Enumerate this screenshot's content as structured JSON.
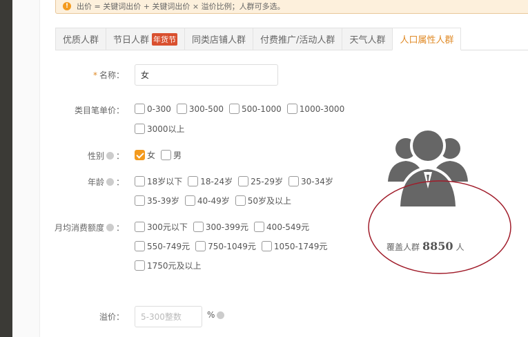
{
  "notice": {
    "text": "出价 = 关键词出价 + 关键词出价 × 溢价比例；人群可多选。"
  },
  "tabs": [
    {
      "label": "优质人群"
    },
    {
      "label": "节日人群",
      "badge": "年货节"
    },
    {
      "label": "同类店铺人群"
    },
    {
      "label": "付费推广/活动人群"
    },
    {
      "label": "天气人群"
    },
    {
      "label": "人口属性人群",
      "active": true
    }
  ],
  "form": {
    "name": {
      "label": "名称：",
      "required": "*",
      "value": "女"
    },
    "price": {
      "label": "类目笔单价：",
      "options": [
        "0-300",
        "300-500",
        "500-1000",
        "1000-3000",
        "3000以上"
      ]
    },
    "gender": {
      "label": "性别",
      "colon": "：",
      "options": [
        "女",
        "男"
      ],
      "checked": "女"
    },
    "age": {
      "label": "年龄",
      "colon": "：",
      "options": [
        "18岁以下",
        "18-24岁",
        "25-29岁",
        "30-34岁",
        "35-39岁",
        "40-49岁",
        "50岁及以上"
      ]
    },
    "spend": {
      "label": "月均消费额度",
      "colon": "：",
      "options": [
        "300元以下",
        "300-399元",
        "400-549元",
        "550-749元",
        "750-1049元",
        "1050-1749元",
        "1750元及以上"
      ]
    },
    "premium": {
      "label": "溢价：",
      "placeholder": "5-300整数",
      "unit": "%"
    }
  },
  "coverage": {
    "prefix": "覆盖人群",
    "count": "8850",
    "suffix": "人"
  },
  "colors": {
    "accent": "#e08a26",
    "checked": "#f39a1e",
    "ellipse": "#a01c2a"
  }
}
